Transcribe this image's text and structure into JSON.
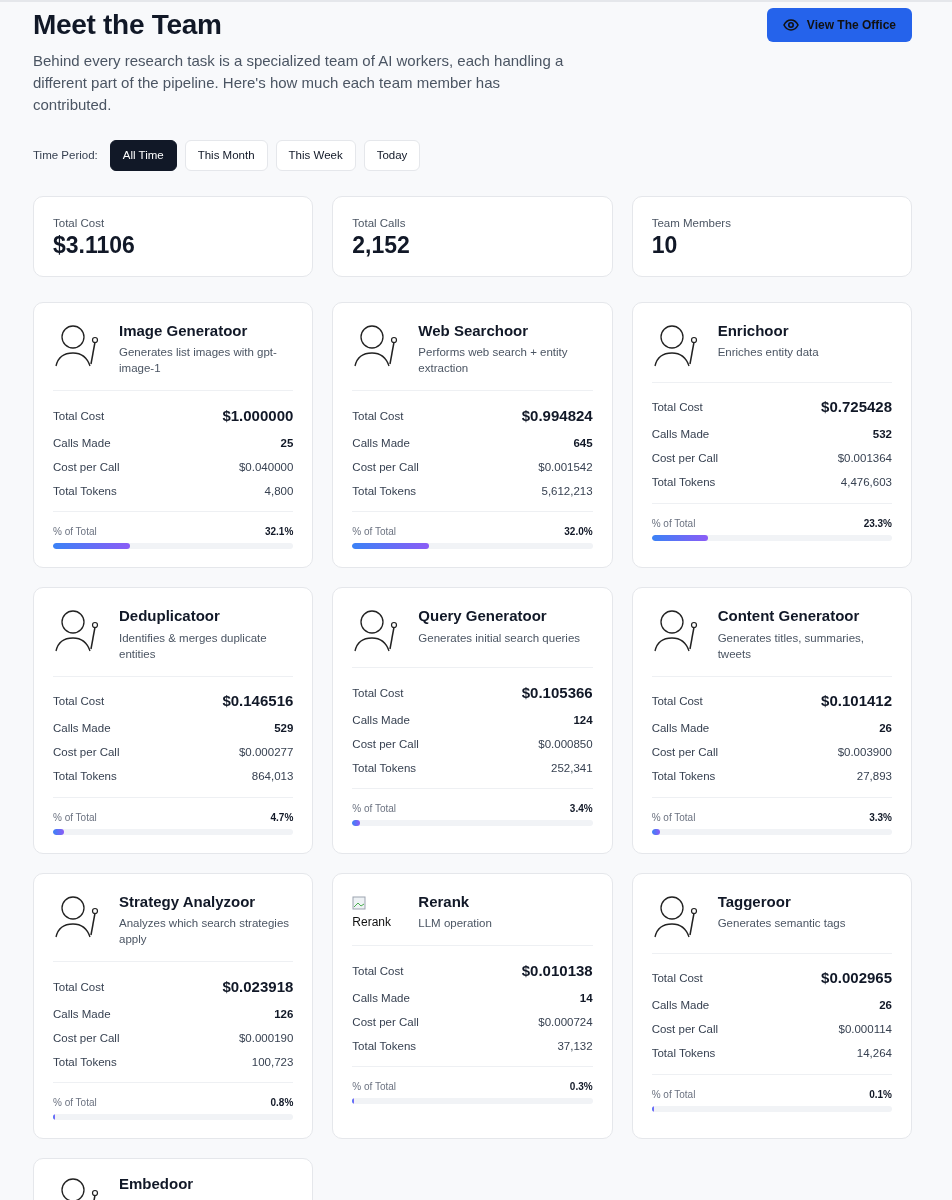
{
  "header": {
    "title": "Meet the Team",
    "description": "Behind every research task is a specialized team of AI workers, each handling a different part of the pipeline. Here's how much each team member has contributed.",
    "action_button": "View The Office"
  },
  "time_period": {
    "label": "Time Period:",
    "options": [
      {
        "label": "All Time",
        "selected": true
      },
      {
        "label": "This Month",
        "selected": false
      },
      {
        "label": "This Week",
        "selected": false
      },
      {
        "label": "Today",
        "selected": false
      }
    ]
  },
  "summary": [
    {
      "label": "Total Cost",
      "value": "$3.1106"
    },
    {
      "label": "Total Calls",
      "value": "2,152"
    },
    {
      "label": "Team Members",
      "value": "10"
    }
  ],
  "members": [
    {
      "name": "Image Generatoor",
      "description": "Generates list images with gpt-image-1",
      "avatar": {
        "kind": "sketch"
      },
      "stats": [
        {
          "kind": "cost",
          "label": "Total Cost",
          "value": "$1.000000"
        },
        {
          "kind": "calls",
          "label": "Calls Made",
          "value": "25"
        },
        {
          "kind": "plain",
          "label": "Cost per Call",
          "value": "$0.040000"
        },
        {
          "kind": "plain",
          "label": "Total Tokens",
          "value": "4,800"
        }
      ],
      "share_label": "% of Total",
      "share": "32.1%",
      "level": 0.321
    },
    {
      "name": "Web Searchoor",
      "description": "Performs web search + entity extraction",
      "avatar": {
        "kind": "sketch"
      },
      "stats": [
        {
          "kind": "cost",
          "label": "Total Cost",
          "value": "$0.994824"
        },
        {
          "kind": "calls",
          "label": "Calls Made",
          "value": "645"
        },
        {
          "kind": "plain",
          "label": "Cost per Call",
          "value": "$0.001542"
        },
        {
          "kind": "plain",
          "label": "Total Tokens",
          "value": "5,612,213"
        }
      ],
      "share_label": "% of Total",
      "share": "32.0%",
      "level": 0.32
    },
    {
      "name": "Enrichoor",
      "description": "Enriches entity data",
      "avatar": {
        "kind": "sketch"
      },
      "stats": [
        {
          "kind": "cost",
          "label": "Total Cost",
          "value": "$0.725428"
        },
        {
          "kind": "calls",
          "label": "Calls Made",
          "value": "532"
        },
        {
          "kind": "plain",
          "label": "Cost per Call",
          "value": "$0.001364"
        },
        {
          "kind": "plain",
          "label": "Total Tokens",
          "value": "4,476,603"
        }
      ],
      "share_label": "% of Total",
      "share": "23.3%",
      "level": 0.233
    },
    {
      "name": "Deduplicatoor",
      "description": "Identifies & merges duplicate entities",
      "avatar": {
        "kind": "sketch"
      },
      "stats": [
        {
          "kind": "cost",
          "label": "Total Cost",
          "value": "$0.146516"
        },
        {
          "kind": "calls",
          "label": "Calls Made",
          "value": "529"
        },
        {
          "kind": "plain",
          "label": "Cost per Call",
          "value": "$0.000277"
        },
        {
          "kind": "plain",
          "label": "Total Tokens",
          "value": "864,013"
        }
      ],
      "share_label": "% of Total",
      "share": "4.7%",
      "level": 0.047
    },
    {
      "name": "Query Generatoor",
      "description": "Generates initial search queries",
      "avatar": {
        "kind": "sketch"
      },
      "stats": [
        {
          "kind": "cost",
          "label": "Total Cost",
          "value": "$0.105366"
        },
        {
          "kind": "calls",
          "label": "Calls Made",
          "value": "124"
        },
        {
          "kind": "plain",
          "label": "Cost per Call",
          "value": "$0.000850"
        },
        {
          "kind": "plain",
          "label": "Total Tokens",
          "value": "252,341"
        }
      ],
      "share_label": "% of Total",
      "share": "3.4%",
      "level": 0.034
    },
    {
      "name": "Content Generatoor",
      "description": "Generates titles, summaries, tweets",
      "avatar": {
        "kind": "sketch"
      },
      "stats": [
        {
          "kind": "cost",
          "label": "Total Cost",
          "value": "$0.101412"
        },
        {
          "kind": "calls",
          "label": "Calls Made",
          "value": "26"
        },
        {
          "kind": "plain",
          "label": "Cost per Call",
          "value": "$0.003900"
        },
        {
          "kind": "plain",
          "label": "Total Tokens",
          "value": "27,893"
        }
      ],
      "share_label": "% of Total",
      "share": "3.3%",
      "level": 0.033
    },
    {
      "name": "Strategy Analyzoor",
      "description": "Analyzes which search strategies apply",
      "avatar": {
        "kind": "sketch"
      },
      "stats": [
        {
          "kind": "cost",
          "label": "Total Cost",
          "value": "$0.023918"
        },
        {
          "kind": "calls",
          "label": "Calls Made",
          "value": "126"
        },
        {
          "kind": "plain",
          "label": "Cost per Call",
          "value": "$0.000190"
        },
        {
          "kind": "plain",
          "label": "Total Tokens",
          "value": "100,723"
        }
      ],
      "share_label": "% of Total",
      "share": "0.8%",
      "level": 0.008
    },
    {
      "name": "Rerank",
      "description": "LLM operation",
      "avatar": {
        "kind": "broken",
        "alt": "Rerank"
      },
      "stats": [
        {
          "kind": "cost",
          "label": "Total Cost",
          "value": "$0.010138"
        },
        {
          "kind": "calls",
          "label": "Calls Made",
          "value": "14"
        },
        {
          "kind": "plain",
          "label": "Cost per Call",
          "value": "$0.000724"
        },
        {
          "kind": "plain",
          "label": "Total Tokens",
          "value": "37,132"
        }
      ],
      "share_label": "% of Total",
      "share": "0.3%",
      "level": 0.003
    },
    {
      "name": "Taggeroor",
      "description": "Generates semantic tags",
      "avatar": {
        "kind": "sketch"
      },
      "stats": [
        {
          "kind": "cost",
          "label": "Total Cost",
          "value": "$0.002965"
        },
        {
          "kind": "calls",
          "label": "Calls Made",
          "value": "26"
        },
        {
          "kind": "plain",
          "label": "Cost per Call",
          "value": "$0.000114"
        },
        {
          "kind": "plain",
          "label": "Total Tokens",
          "value": "14,264"
        }
      ],
      "share_label": "% of Total",
      "share": "0.1%",
      "level": 0.001
    },
    {
      "name": "Embedoor",
      "avatar": {
        "kind": "sketch"
      }
    }
  ]
}
